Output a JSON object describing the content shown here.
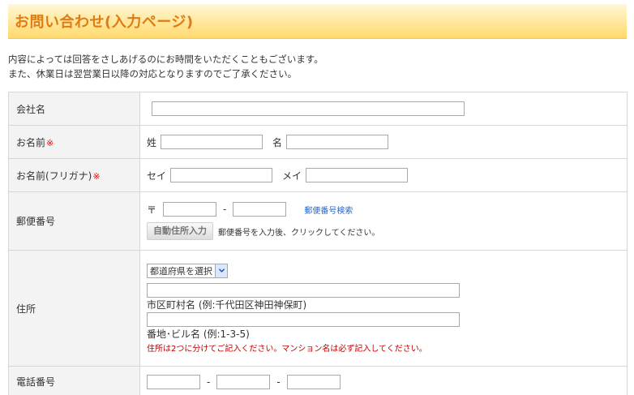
{
  "header": {
    "title": "お問い合わせ(入力ページ)"
  },
  "intro": {
    "line1": "内容によっては回答をさしあげるのにお時間をいただくこともございます。",
    "line2": "また、休業日は翌営業日以降の対応となりますのでご了承ください。"
  },
  "form": {
    "company": {
      "label": "会社名",
      "value": ""
    },
    "name": {
      "label": "お名前",
      "required_mark": "※",
      "sei_label": "姓",
      "mei_label": "名",
      "sei_value": "",
      "mei_value": ""
    },
    "kana": {
      "label": "お名前(フリガナ)",
      "required_mark": "※",
      "sei_label": "セイ",
      "mei_label": "メイ",
      "sei_value": "",
      "mei_value": ""
    },
    "postal": {
      "label": "郵便番号",
      "prefix": "〒",
      "separator": "-",
      "search_link": "郵便番号検索",
      "button_label": "自動住所入力",
      "help_text": "郵便番号を入力後、クリックしてください。",
      "first_value": "",
      "second_value": ""
    },
    "address": {
      "label": "住所",
      "prefecture_selected": "都道府県を選択",
      "city_value": "",
      "city_hint": "市区町村名 (例:千代田区神田神保町)",
      "street_value": "",
      "street_hint": "番地･ビル名 (例:1-3-5)",
      "note": "住所は2つに分けてご記入ください。マンション名は必ず記入してください。"
    },
    "phone": {
      "label": "電話番号",
      "separator": "-",
      "first_value": "",
      "second_value": "",
      "third_value": ""
    }
  },
  "colors": {
    "header_title": "#e07b14",
    "required_mark": "#ff0000",
    "note": "#c00000",
    "link": "#2a66c8"
  },
  "icons": {
    "select_arrow": "chevron-down-icon"
  }
}
